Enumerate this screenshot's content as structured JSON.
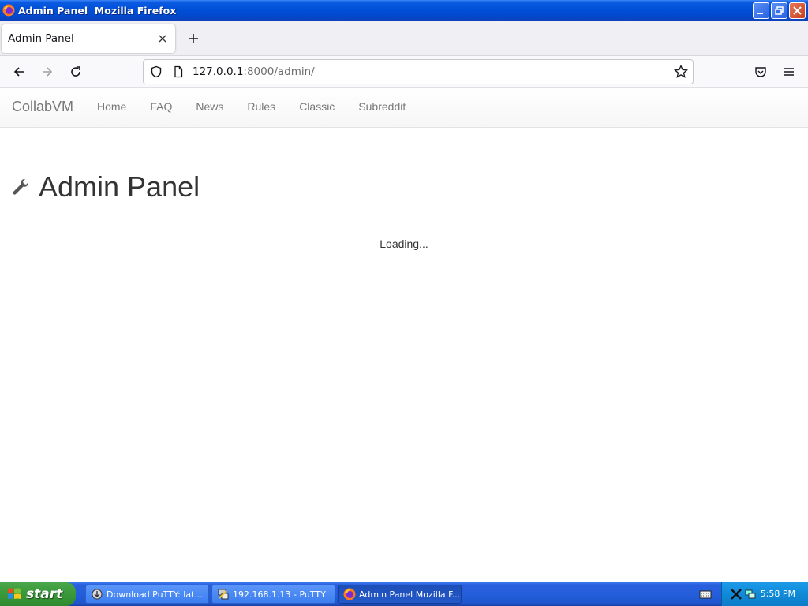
{
  "window": {
    "title": "Admin Panel  Mozilla Firefox"
  },
  "browser": {
    "tab_label": "Admin Panel",
    "url_host": "127.0.0.1",
    "url_rest": ":8000/admin/"
  },
  "site": {
    "brand": "CollabVM",
    "nav": [
      "Home",
      "FAQ",
      "News",
      "Rules",
      "Classic",
      "Subreddit"
    ]
  },
  "page": {
    "heading": "Admin Panel",
    "status": "Loading..."
  },
  "taskbar": {
    "start_label": "start",
    "tasks": [
      {
        "label": "Download PuTTY: lat...",
        "icon": "putty-download-icon"
      },
      {
        "label": "192.168.1.13 - PuTTY",
        "icon": "putty-icon"
      },
      {
        "label": "Admin Panel  Mozilla F...",
        "icon": "firefox-icon"
      }
    ],
    "clock": "5:58 PM"
  },
  "colors": {
    "xp_blue": "#0150d8",
    "start_green": "#3c9a3c",
    "nav_text": "#777777",
    "heading_text": "#333333"
  }
}
